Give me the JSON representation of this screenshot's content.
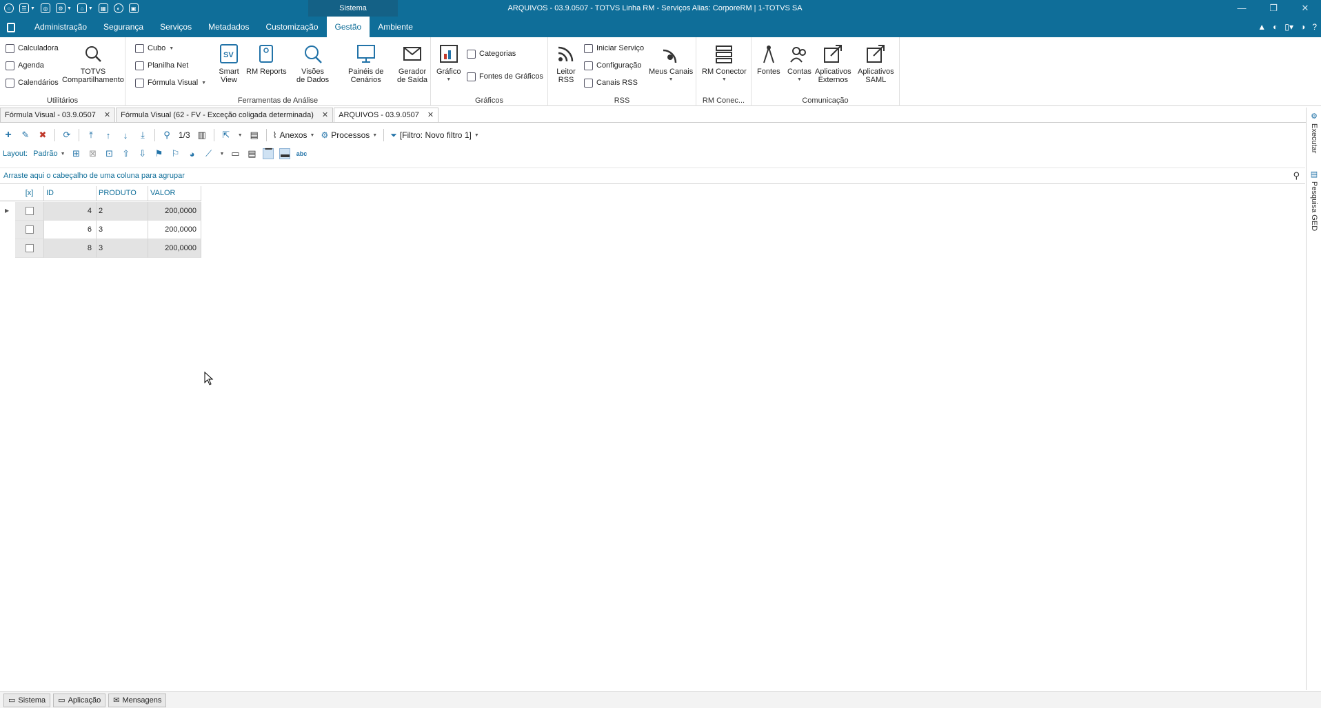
{
  "titlebar": {
    "context_tab": "Sistema",
    "window_title": "ARQUIVOS - 03.9.0507 - TOTVS Linha RM - Serviços  Alias: CorporeRM | 1-TOTVS SA"
  },
  "menu": {
    "tabs": [
      "Administração",
      "Segurança",
      "Serviços",
      "Metadados",
      "Customização",
      "Gestão",
      "Ambiente"
    ],
    "active": "Gestão"
  },
  "ribbon": {
    "utilitarios": {
      "caption": "Utilitários",
      "calculadora": "Calculadora",
      "agenda": "Agenda",
      "calendarios": "Calendários",
      "totvs_line1": "TOTVS",
      "totvs_line2": "Compartilhamento"
    },
    "ferramentas": {
      "caption": "Ferramentas de Análise",
      "cubo": "Cubo",
      "planilha": "Planilha Net",
      "formula": "Fórmula Visual",
      "smart1": "Smart",
      "smart2": "View",
      "rmreports": "RM Reports",
      "visoes1": "Visões",
      "visoes2": "de Dados",
      "paineis1": "Painéis de",
      "paineis2": "Cenários",
      "gerador1": "Gerador",
      "gerador2": "de Saída"
    },
    "graficos": {
      "caption": "Gráficos",
      "grafico": "Gráfico",
      "categorias": "Categorias",
      "fontes": "Fontes de Gráficos"
    },
    "rss": {
      "caption": "RSS",
      "leitor1": "Leitor",
      "leitor2": "RSS",
      "iniciar": "Iniciar Serviço",
      "config": "Configuração",
      "canais": "Canais RSS",
      "meus": "Meus Canais"
    },
    "rmconec": {
      "caption": "RM Conec...",
      "conector": "RM Conector"
    },
    "comunicacao": {
      "caption": "Comunicação",
      "fontes": "Fontes",
      "contas": "Contas",
      "apl1": "Aplicativos",
      "apl2": "Externos",
      "saml1": "Aplicativos",
      "saml2": "SAML"
    }
  },
  "doc_tabs": [
    "Fórmula Visual - 03.9.0507",
    "Fórmula Visual (62 - FV - Exceção coligada determinada)",
    "ARQUIVOS - 03.9.0507"
  ],
  "toolbar": {
    "page": "1/3",
    "anexos": "Anexos",
    "processos": "Processos",
    "filtro": "[Filtro: Novo filtro 1]",
    "layout_label": "Layout:",
    "layout_value": "Padrão"
  },
  "group_hint": "Arraste aqui o cabeçalho de uma coluna para agrupar",
  "grid": {
    "columns": [
      "[x]",
      "ID",
      "PRODUTO",
      "VALOR"
    ],
    "rows": [
      {
        "id": "4",
        "produto": "2",
        "valor": "200,0000"
      },
      {
        "id": "6",
        "produto": "3",
        "valor": "200,0000"
      },
      {
        "id": "8",
        "produto": "3",
        "valor": "200,0000"
      }
    ]
  },
  "side_panel": {
    "executar": "Executar",
    "pesquisa": "Pesquisa GED"
  },
  "statusbar": {
    "sistema": "Sistema",
    "aplicacao": "Aplicação",
    "mensagens": "Mensagens"
  }
}
